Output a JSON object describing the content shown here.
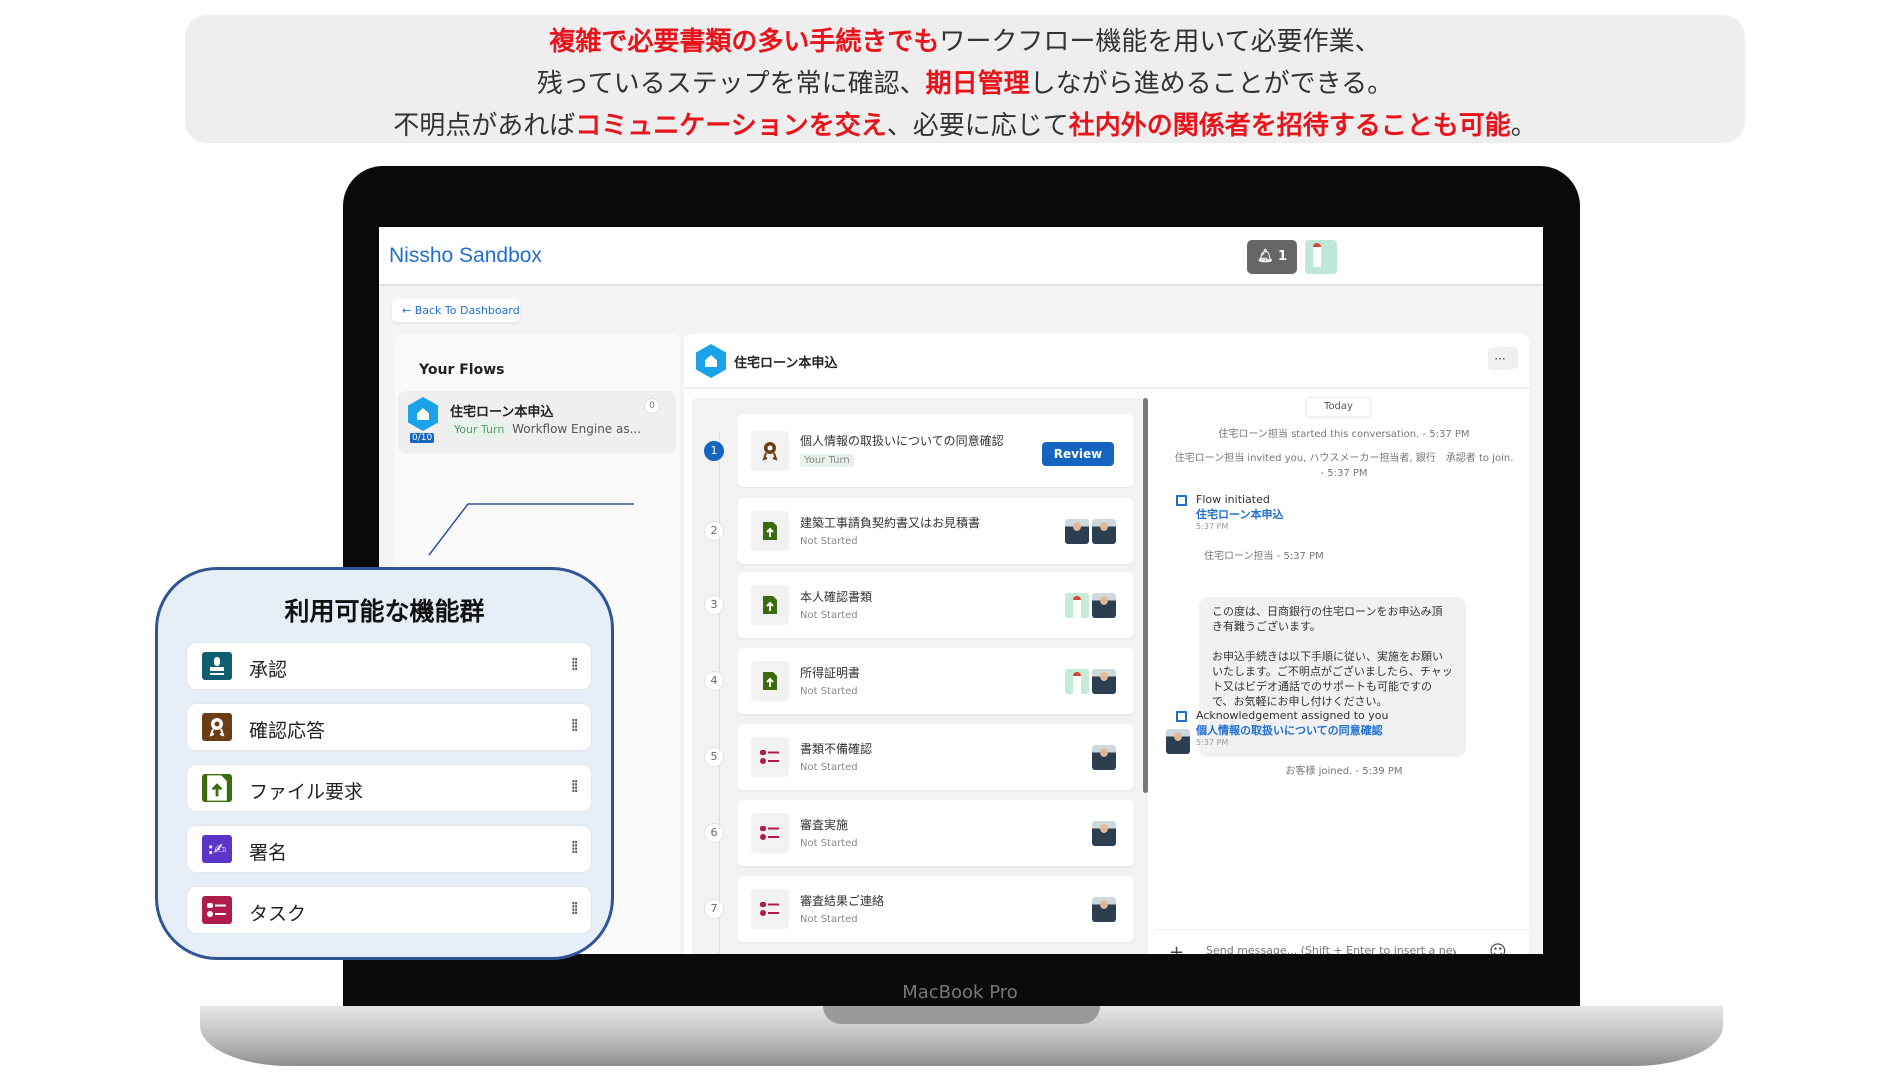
{
  "banner": {
    "lines": [
      [
        {
          "text": "複雑で必要書類の多い手続きでも",
          "em": true
        },
        {
          "text": "ワークフロー機能を用いて必要作業、",
          "em": false
        }
      ],
      [
        {
          "text": "残っているステップを常に確認、",
          "em": false
        },
        {
          "text": "期日管理",
          "em": true
        },
        {
          "text": "しながら進めることができる。",
          "em": false
        }
      ],
      [
        {
          "text": "不明点があれば",
          "em": false
        },
        {
          "text": "コミュニケーションを交え",
          "em": true
        },
        {
          "text": "、必要に応じて",
          "em": false
        },
        {
          "text": "社内外の関係者を招待することも可能",
          "em": true
        },
        {
          "text": "。",
          "em": false
        }
      ]
    ]
  },
  "device_label": "MacBook Pro",
  "app": {
    "title": "Nissho Sandbox",
    "notifications": "1",
    "back_label": "Back To Dashboard",
    "your_flows": "Your Flows",
    "flow": {
      "name": "住宅ローン本申込",
      "badge": "Your Turn",
      "sub": "Workflow Engine as...",
      "count": "0",
      "progress": "0/10"
    },
    "main_title": "住宅ローン本申込",
    "steps": [
      {
        "num": "1",
        "name": "個人情報の取扱いについての同意確認",
        "status": "Your Turn",
        "icon": "award-icon",
        "action": "Review",
        "assignees": []
      },
      {
        "num": "2",
        "name": "建築工事請負契約書又はお見積書",
        "status": "Not Started",
        "icon": "file-upload-icon",
        "assignees": [
          "m",
          "m"
        ]
      },
      {
        "num": "3",
        "name": "本人確認書類",
        "status": "Not Started",
        "icon": "file-upload-icon",
        "assignees": [
          "f",
          "m"
        ]
      },
      {
        "num": "4",
        "name": "所得証明書",
        "status": "Not Started",
        "icon": "file-upload-icon",
        "assignees": [
          "f",
          "m"
        ]
      },
      {
        "num": "5",
        "name": "書類不備確認",
        "status": "Not Started",
        "icon": "task-icon",
        "assignees": [
          "m"
        ]
      },
      {
        "num": "6",
        "name": "審査実施",
        "status": "Not Started",
        "icon": "task-icon",
        "assignees": [
          "m"
        ]
      },
      {
        "num": "7",
        "name": "審査結果ご連絡",
        "status": "Not Started",
        "icon": "task-icon",
        "assignees": [
          "m"
        ]
      }
    ],
    "chat": {
      "today": "Today",
      "sys1": "住宅ローン担当 started this conversation. - 5:37 PM",
      "sys2": "住宅ローン担当 invited you, ハウスメーカー担当者, 銀行　承認者 to join. - 5:37 PM",
      "ev1": {
        "title": "Flow initiated",
        "link": "住宅ローン本申込",
        "time": "5:37 PM"
      },
      "sender": "住宅ローン担当 - 5:37 PM",
      "message": "この度は、日商銀行の住宅ローンをお申込み頂き有難うございます。\n\nお申込手続きは以下手順に従い、実施をお願いいたします。ご不明点がございましたら、チャット又はビデオ通話でのサポートも可能ですので、お気軽にお申し付けください。",
      "ev2": {
        "title": "Acknowledgement assigned to you",
        "link": "個人情報の取扱いについての同意確認",
        "time": "5:37 PM"
      },
      "sys3": "お客様 joined. - 5:39 PM",
      "placeholder": "Send message... (Shift + Enter to insert a new line)"
    }
  },
  "features": {
    "title": "利用可能な機能群",
    "items": [
      {
        "label": "承認",
        "icon": "stamp-icon",
        "color": "#0e5e6f"
      },
      {
        "label": "確認応答",
        "icon": "award-icon",
        "color": "#6b3d14"
      },
      {
        "label": "ファイル要求",
        "icon": "file-upload-icon",
        "color": "#3a6b0e"
      },
      {
        "label": "署名",
        "icon": "signature-icon",
        "color": "#5b35c9"
      },
      {
        "label": "タスク",
        "icon": "task-icon",
        "color": "#b01c4a"
      }
    ]
  },
  "colors": {
    "accent": "#1565c0",
    "emphasis": "#e8141c",
    "callout_border": "#2f5597"
  }
}
